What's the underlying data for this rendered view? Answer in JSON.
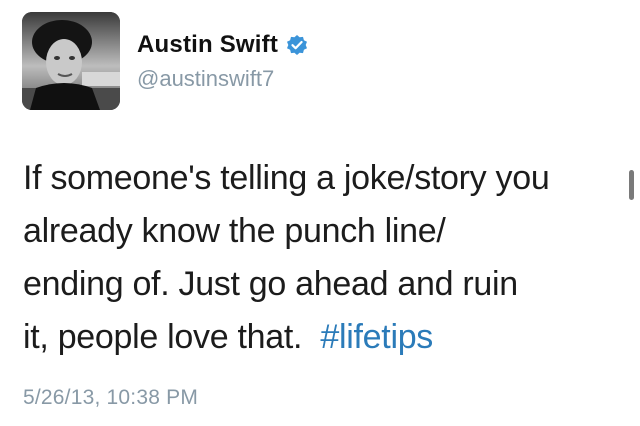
{
  "user": {
    "display_name": "Austin Swift",
    "handle": "@austinswift7",
    "verified": true,
    "avatar_icon": "profile-photo"
  },
  "tweet": {
    "text_lines": [
      "If someone's telling a joke/story you",
      "already know the punch line/",
      "ending of. Just go ahead and ruin",
      "it, people love that."
    ],
    "hashtag": "#lifetips",
    "timestamp": "5/26/13, 10:38 PM"
  },
  "colors": {
    "verified_badge": "#3b94d9",
    "hashtag": "#2b7bb9",
    "meta_text": "#8899a6",
    "body_text": "#1c1c1c"
  }
}
